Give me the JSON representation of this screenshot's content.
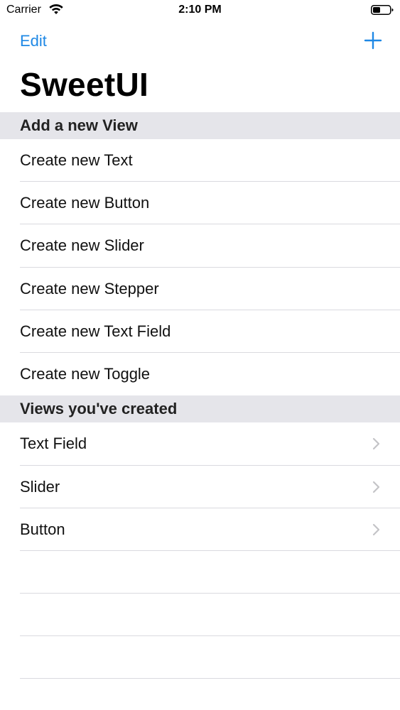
{
  "status_bar": {
    "carrier": "Carrier",
    "time": "2:10 PM",
    "icons": [
      "wifi-icon",
      "battery-icon"
    ]
  },
  "nav": {
    "edit_label": "Edit",
    "add_icon": "plus-icon",
    "title": "SweetUI"
  },
  "sections": [
    {
      "header": "Add a new View",
      "items": [
        {
          "label": "Create new Text"
        },
        {
          "label": "Create new Button"
        },
        {
          "label": "Create new Slider"
        },
        {
          "label": "Create new Stepper"
        },
        {
          "label": "Create new Text Field"
        },
        {
          "label": "Create new Toggle"
        }
      ]
    },
    {
      "header": "Views you've created",
      "items": [
        {
          "label": "Text Field",
          "icon": "chevron-right-icon"
        },
        {
          "label": "Slider",
          "icon": "chevron-right-icon"
        },
        {
          "label": "Button",
          "icon": "chevron-right-icon"
        }
      ]
    }
  ],
  "colors": {
    "accent": "#1E88E5",
    "section_header_bg": "#E5E5EA",
    "separator": "#DADADF",
    "chevron": "#C4C4C7"
  }
}
